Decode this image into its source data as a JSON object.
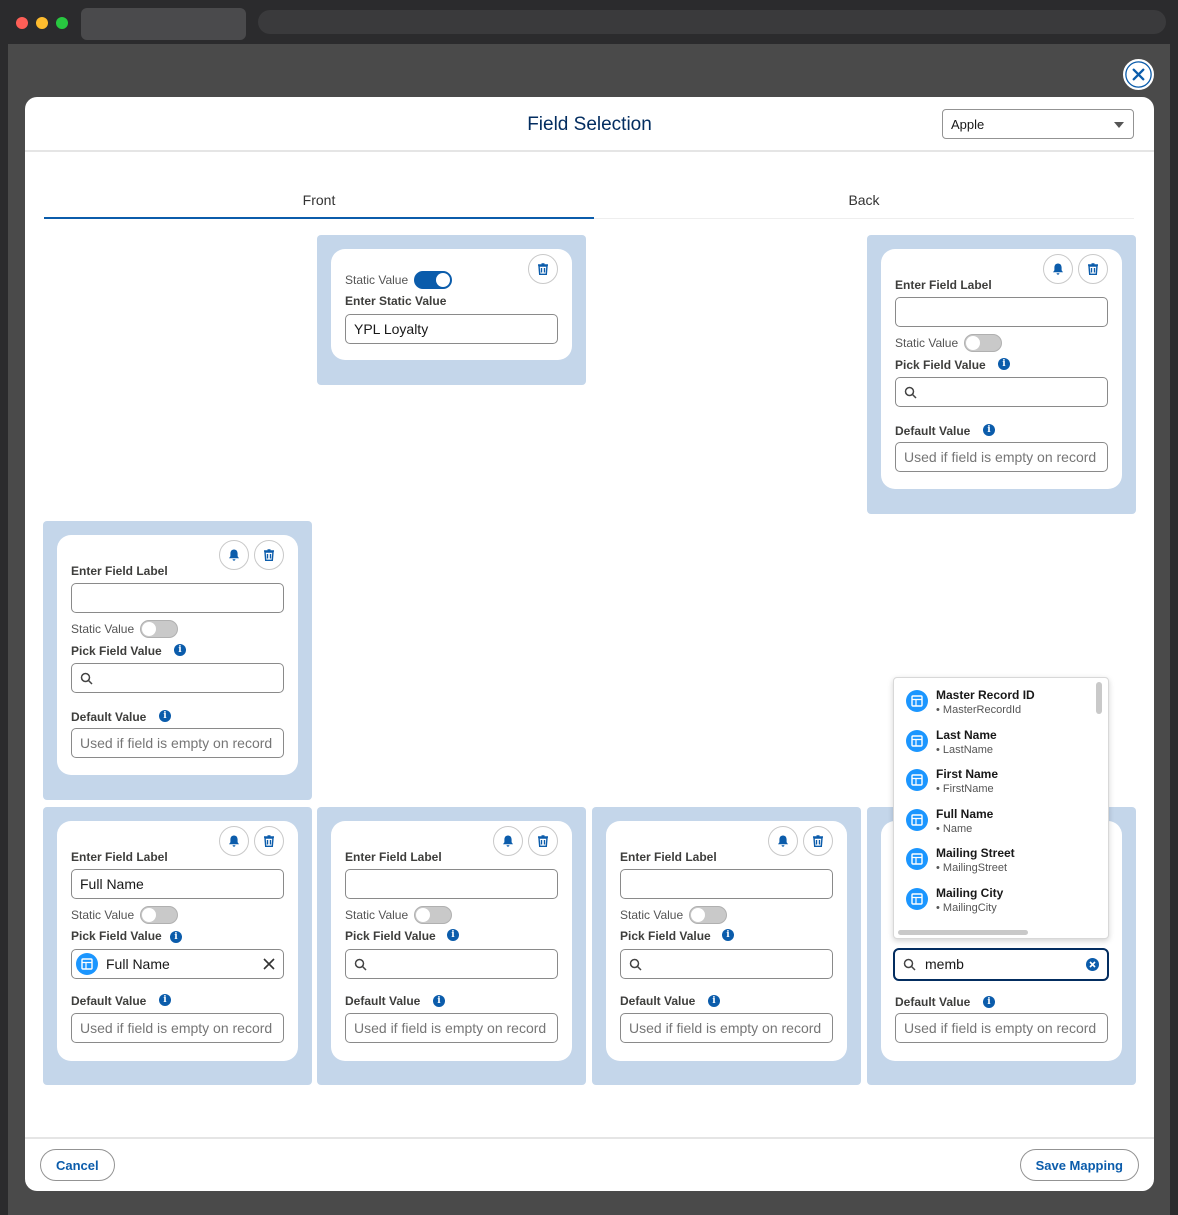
{
  "modal": {
    "title": "Field Selection",
    "org_select": "Apple",
    "tabs": [
      "Front",
      "Back"
    ]
  },
  "labels": {
    "enter_field_label": "Enter Field Label",
    "static_value": "Static Value",
    "enter_static_value": "Enter Static Value",
    "pick_field_value": "Pick Field Value",
    "default_value": "Default Value",
    "default_placeholder": "Used if field is empty on record"
  },
  "cards": {
    "front_top": {
      "static_value_on": true,
      "static_value": "YPL Loyalty"
    },
    "back_top": {
      "field_label": "",
      "static_value_on": false,
      "pick_value": ""
    },
    "front_left": {
      "field_label": "",
      "static_value_on": false,
      "pick_value": ""
    },
    "row_1": {
      "field_label": "Full Name",
      "static_value_on": false,
      "pick_value": "Full Name"
    },
    "row_2": {
      "field_label": "",
      "static_value_on": false,
      "pick_value": ""
    },
    "row_3": {
      "field_label": "",
      "static_value_on": false,
      "pick_value": ""
    },
    "row_4": {
      "search_text": "memb"
    }
  },
  "dropdown": {
    "items": [
      {
        "name": "Master Record ID",
        "api": "• MasterRecordId"
      },
      {
        "name": "Last Name",
        "api": "• LastName"
      },
      {
        "name": "First Name",
        "api": "• FirstName"
      },
      {
        "name": "Full Name",
        "api": "• Name"
      },
      {
        "name": "Mailing Street",
        "api": "• MailingStreet"
      },
      {
        "name": "Mailing City",
        "api": "• MailingCity"
      }
    ]
  },
  "footer": {
    "cancel": "Cancel",
    "save": "Save Mapping"
  },
  "colors": {
    "brand": "#0b5cab",
    "slot": "#c4d6ea",
    "record_icon": "#1b96ff"
  },
  "icons": [
    "close-icon",
    "bell-icon",
    "trash-icon",
    "search-icon",
    "info-icon",
    "record-icon",
    "clear-icon",
    "chevron-down-icon"
  ]
}
